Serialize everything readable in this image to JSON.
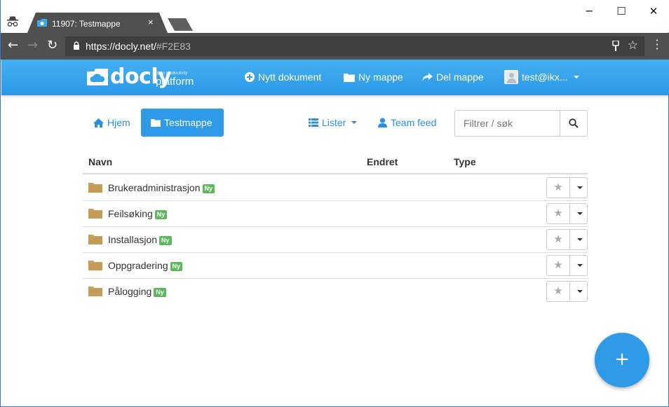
{
  "browser": {
    "tab_title": "11907: Testmappe",
    "tab_close": "×",
    "url_host": "https://docly.net/",
    "url_rest": "#F2E83",
    "window_controls": [
      "─",
      "☐",
      "✕"
    ]
  },
  "brand": {
    "logo_word": "docly",
    "tagline": "open productivity",
    "platform": "platform"
  },
  "app_nav": {
    "new_document": "Nytt dokument",
    "new_folder": "Ny mappe",
    "share_folder": "Del mappe",
    "user": "test@ikx..."
  },
  "breadcrumb": {
    "home": "Hjem",
    "current": "Testmappe"
  },
  "tools": {
    "lists": "Lister",
    "team_feed": "Team feed",
    "search_placeholder": "Filtrer / søk"
  },
  "table": {
    "headers": {
      "name": "Navn",
      "changed": "Endret",
      "type": "Type"
    },
    "rows": [
      {
        "name": "Brukeradministrasjon",
        "badge": "Ny"
      },
      {
        "name": "Feilsøking",
        "badge": "Ny"
      },
      {
        "name": "Installasjon",
        "badge": "Ny"
      },
      {
        "name": "Oppgradering",
        "badge": "Ny"
      },
      {
        "name": "Pålogging",
        "badge": "Ny"
      }
    ]
  },
  "fab": {
    "label": "+"
  },
  "colors": {
    "accent": "#2f9be8",
    "badge": "#5cb85c",
    "folder": "#c9a15c",
    "chrome_toolbar": "#505050"
  }
}
